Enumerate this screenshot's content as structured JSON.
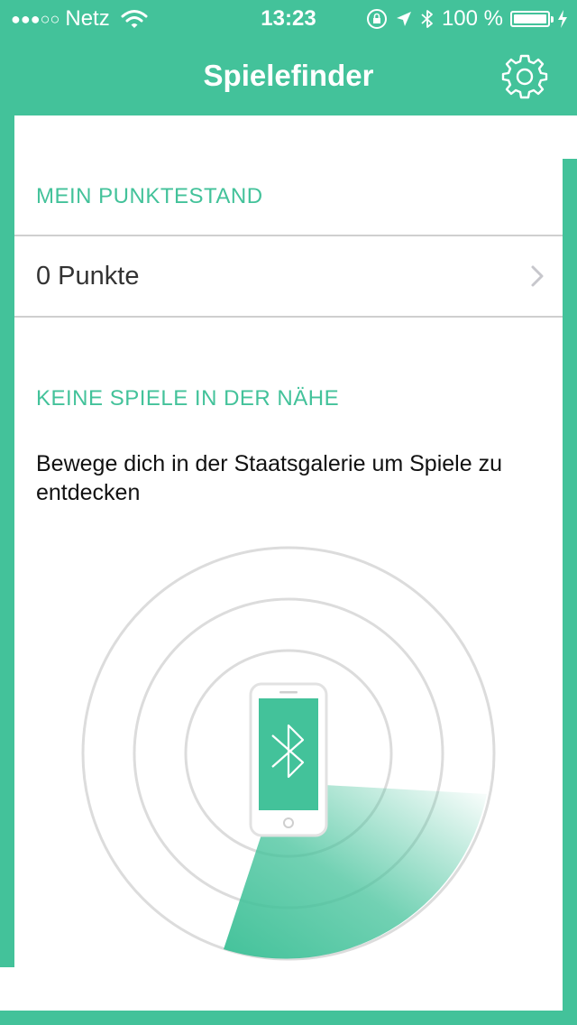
{
  "status_bar": {
    "signal": "●●●○○",
    "carrier": "Netz",
    "time": "13:23",
    "battery_percent": "100 %",
    "battery_level": 1.0,
    "icons": [
      "wifi-icon",
      "orientation-lock-icon",
      "location-arrow-icon",
      "bluetooth-icon",
      "battery-icon",
      "charging-bolt-icon"
    ]
  },
  "nav": {
    "title": "Spielefinder",
    "settings_icon": "gear-icon"
  },
  "score_section": {
    "header": "MEIN PUNKTESTAND",
    "value": "0 Punkte",
    "chevron_icon": "chevron-right-icon"
  },
  "games_section": {
    "header": "KEINE SPIELE IN DER NÄHE",
    "description": "Bewege dich in der Staatsgalerie um Spiele zu entdecken"
  },
  "radar": {
    "rings": 3,
    "device_icon": "phone-icon",
    "symbol_icon": "bluetooth-icon"
  },
  "colors": {
    "accent": "#43c29a",
    "divider": "#cfcfcf",
    "ring": "#dcdcdc"
  }
}
